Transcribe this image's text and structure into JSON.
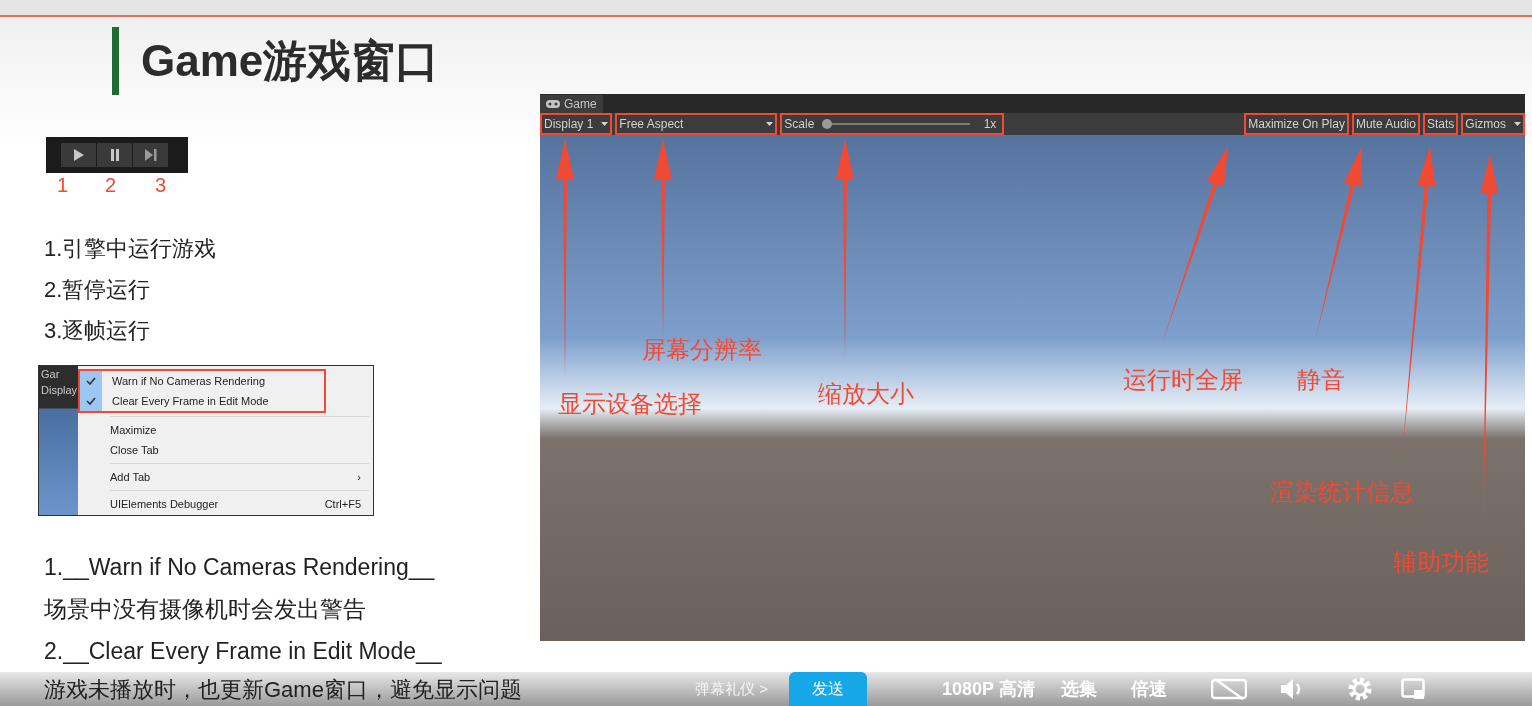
{
  "slide": {
    "title": "Game游戏窗口"
  },
  "play_controls": {
    "buttons": [
      {
        "kind": "play"
      },
      {
        "kind": "pause"
      },
      {
        "kind": "step"
      }
    ],
    "numbers": [
      "1",
      "2",
      "3"
    ]
  },
  "steps": [
    "1.引擎中运行游戏",
    "2.暂停运行",
    "3.逐帧运行"
  ],
  "context_menu": {
    "behind_texts": [
      "Gar",
      "Display"
    ],
    "items": [
      {
        "kind": "check",
        "label": "Warn if No Cameras Rendering",
        "checked": true,
        "highlighted": true
      },
      {
        "kind": "check",
        "label": "Clear Every Frame in Edit Mode",
        "checked": true,
        "highlighted": true
      },
      {
        "kind": "separator"
      },
      {
        "kind": "item",
        "label": "Maximize"
      },
      {
        "kind": "item",
        "label": "Close Tab"
      },
      {
        "kind": "separator"
      },
      {
        "kind": "submenu",
        "label": "Add Tab",
        "arrow": "›"
      },
      {
        "kind": "separator"
      },
      {
        "kind": "item",
        "label": "UIElements Debugger",
        "shortcut": "Ctrl+F5"
      }
    ]
  },
  "notes": [
    "1.__Warn if No Cameras Rendering__",
    "场景中没有摄像机时会发出警告",
    "2.__Clear Every Frame in Edit Mode__",
    "游戏未播放时，也更新Game窗口，避免显示问题"
  ],
  "game_window": {
    "tab": "Game",
    "toolbar": [
      {
        "kind": "dropdown",
        "label": "Display 1",
        "highlighted": true
      },
      {
        "kind": "aspect_dropdown",
        "label": "Free Aspect",
        "highlighted": true
      },
      {
        "kind": "slider",
        "label": "Scale",
        "level": 0.0,
        "reading": "1x",
        "highlighted": true
      },
      {
        "kind": "spacer"
      },
      {
        "kind": "toggle",
        "label": "Maximize On Play",
        "highlighted": true
      },
      {
        "kind": "toggle",
        "label": "Mute Audio",
        "highlighted": true
      },
      {
        "kind": "toggle",
        "label": "Stats",
        "highlighted": true
      },
      {
        "kind": "dropdown",
        "label": "Gizmos",
        "highlighted": true
      }
    ],
    "annotations": [
      "显示设备选择",
      "屏幕分辨率",
      "缩放大小",
      "运行时全屏",
      "静音",
      "渲染统计信息",
      "辅助功能"
    ]
  },
  "player_bar": {
    "danmaku_etiquette": "弹幕礼仪 >",
    "send": "发送",
    "quality": "1080P 高清",
    "episodes": "选集",
    "speed": "倍速"
  }
}
